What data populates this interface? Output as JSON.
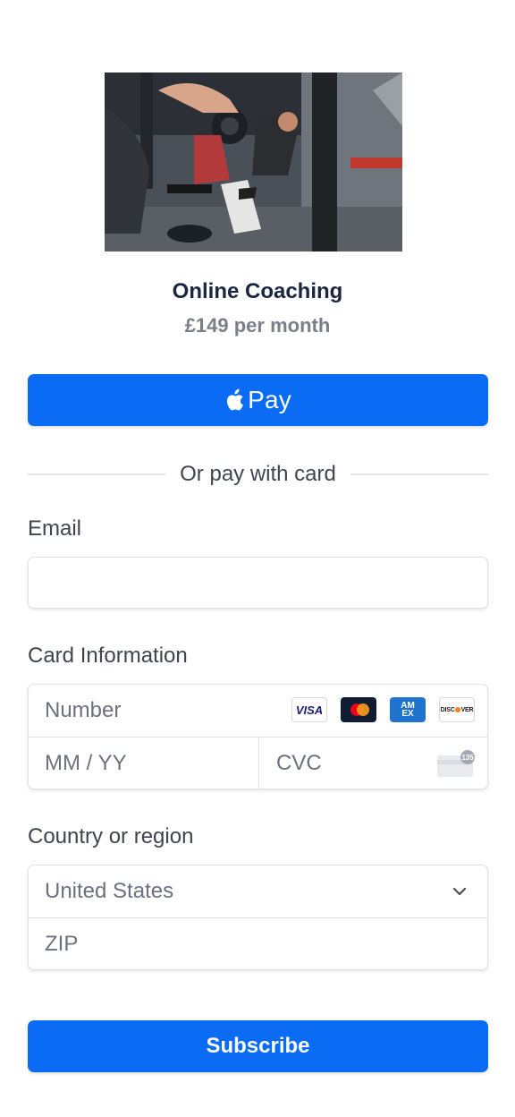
{
  "product": {
    "name": "Online Coaching",
    "price": "£149 per month",
    "image_icon": "gym-photo"
  },
  "apple_pay": {
    "label": "Pay",
    "icon": "apple-logo-icon"
  },
  "divider": {
    "text": "Or pay with card"
  },
  "email": {
    "label": "Email",
    "value": "",
    "placeholder": ""
  },
  "card": {
    "label": "Card Information",
    "number_placeholder": "Number",
    "expiry_placeholder": "MM / YY",
    "cvc_placeholder": "CVC",
    "cvc_hint": "135",
    "brands": {
      "visa": "VISA",
      "mastercard": "mastercard",
      "amex_top": "AM",
      "amex_bottom": "EX",
      "discover": "DISC VER"
    }
  },
  "country": {
    "label": "Country or region",
    "selected": "United States",
    "zip_placeholder": "ZIP"
  },
  "subscribe": {
    "label": "Subscribe"
  },
  "colors": {
    "accent": "#0a6cf5",
    "title": "#1a2540",
    "muted": "#7a7f8a"
  }
}
